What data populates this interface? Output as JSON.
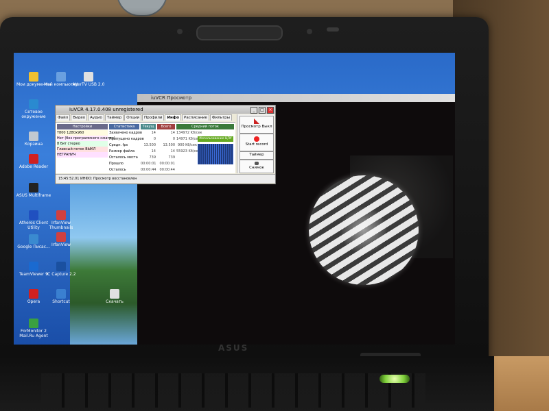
{
  "laptop": {
    "brand": "ASUS"
  },
  "desktop": {
    "icons": [
      {
        "label": "Мои документы",
        "color": "#f0c030"
      },
      {
        "label": "Мой компьютер",
        "color": "#6aa0e0"
      },
      {
        "label": "AVerTV USB 2.0",
        "color": "#e0e0e0"
      },
      {
        "label": "Сетевое окружение",
        "color": "#2a8ad0"
      },
      {
        "label": "Корзина",
        "color": "#c0c8d0"
      },
      {
        "label": "Adobe Reader",
        "color": "#d02020"
      },
      {
        "label": "ASUS Multiframe",
        "color": "#222222"
      },
      {
        "label": "Atheros Client Utility",
        "color": "#2050c0"
      },
      {
        "label": "IrfanView Thumbnails",
        "color": "#d04040"
      },
      {
        "label": "IrfanView",
        "color": "#d04040"
      },
      {
        "label": "Google Пиcaс...",
        "color": "#3a8ad0"
      },
      {
        "label": "TeamViewer 9",
        "color": "#1a6ad0"
      },
      {
        "label": "IC Capture 2.2",
        "color": "#1a50a0"
      },
      {
        "label": "Opera",
        "color": "#d02020"
      },
      {
        "label": "Shortcut",
        "color": "#3a80d0"
      },
      {
        "label": "Скачать",
        "color": "#e0e0e0"
      },
      {
        "label": "ForMonitor 2 Mail.Ru Agent",
        "color": "#3aa040"
      }
    ]
  },
  "preview": {
    "title": "iuVCR Просмотр"
  },
  "main": {
    "title": "iuVCR 4.17.0.408 unregistered",
    "tabs": [
      "Файл",
      "Видео",
      "Аудио",
      "Таймер",
      "Опции",
      "Профили",
      "Инфо",
      "Расписание",
      "Фильтры"
    ],
    "active_tab": "Инфо",
    "headers": {
      "settings": "Настройки",
      "stats": "Статистика",
      "current": "Текущ",
      "total": "Всего",
      "stream": "Средний поток"
    },
    "settings_lines": [
      "Y800 1280x960",
      "Нет (без программного сжатия)",
      "8 бит стерео",
      "Главный поток ВЫКЛ",
      "НЕГРАНИЧ"
    ],
    "stats": [
      {
        "label": "Захвачено кадров",
        "current": "14",
        "total": "14",
        "stream": "134972 Kб/сек"
      },
      {
        "label": "Пропущено кадров",
        "current": "0",
        "total": "0",
        "stream": "14971 Kб/сек"
      },
      {
        "label": "Средн. fps",
        "current": "13.500",
        "total": "13.500",
        "stream": "900 Kб/сек"
      },
      {
        "label": "Размер файла",
        "current": "14",
        "total": "14",
        "stream": "55923 Kб/сек"
      },
      {
        "label": "Осталось места",
        "current": "739",
        "total": "739",
        "stream": ""
      },
      {
        "label": "Прошло",
        "current": "00:00:01",
        "total": "00:00:01",
        "stream": ""
      },
      {
        "label": "Осталось",
        "current": "00:00:44",
        "total": "00:00:44",
        "stream": ""
      }
    ],
    "graph_label": "Использование ЦПУ",
    "side_buttons": [
      "Просмотр Выкл",
      "Start record",
      "Таймер",
      "Снимок"
    ],
    "status": "15:45:52.01 ИНФО: Просмотр восстановлен"
  }
}
